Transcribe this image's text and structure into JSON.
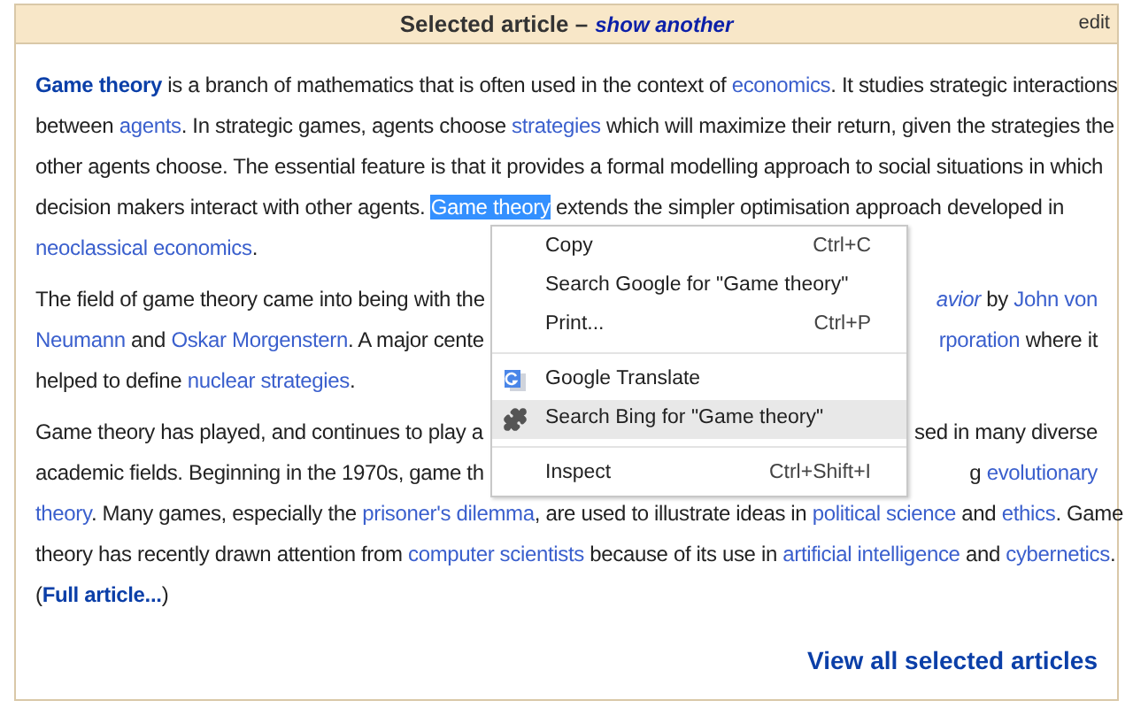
{
  "header": {
    "title": "Selected article –",
    "link": "show another",
    "edit": "edit"
  },
  "paragraphs": [
    [
      {
        "left": [
          {
            "text": "Game theory",
            "link": true,
            "bold": true
          },
          {
            "text": " is a branch of mathematics that is often used in the context of "
          },
          {
            "text": "economics",
            "link": true
          },
          {
            "text": ". It studies strategic interactions"
          }
        ]
      },
      {
        "left": [
          {
            "text": "between "
          },
          {
            "text": "agents",
            "link": true
          },
          {
            "text": ". In strategic games, agents choose "
          },
          {
            "text": "strategies",
            "link": true
          },
          {
            "text": " which will maximize their return, given the strategies the"
          }
        ]
      },
      {
        "left": [
          {
            "text": "other agents choose. The essential feature is that it provides a formal modelling approach to social situations in which"
          }
        ]
      },
      {
        "left": [
          {
            "text": "decision makers interact with other agents. "
          },
          {
            "text": "Game theory",
            "highlighted": true
          },
          {
            "text": " extends the simpler optimisation approach developed in"
          }
        ]
      },
      {
        "left": [
          {
            "text": "neoclassical economics",
            "link": true
          },
          {
            "text": "."
          }
        ]
      }
    ],
    [
      {
        "left": [
          {
            "text": "The field of game theory came into being with the"
          }
        ],
        "right": [
          {
            "text": "avior",
            "link": true,
            "italic": true
          },
          {
            "text": " by "
          },
          {
            "text": "John von",
            "link": true
          }
        ]
      },
      {
        "left": [
          {
            "text": "Neumann",
            "link": true
          },
          {
            "text": " and "
          },
          {
            "text": "Oskar Morgenstern",
            "link": true
          },
          {
            "text": ". A major cente"
          }
        ],
        "right": [
          {
            "text": "rporation",
            "link": true
          },
          {
            "text": " where it"
          }
        ]
      },
      {
        "left": [
          {
            "text": "helped to define "
          },
          {
            "text": "nuclear strategies",
            "link": true
          },
          {
            "text": "."
          }
        ]
      }
    ],
    [
      {
        "left": [
          {
            "text": "Game theory has played, and continues to play a"
          }
        ],
        "right": [
          {
            "text": "sed in many diverse"
          }
        ]
      },
      {
        "left": [
          {
            "text": "academic fields. Beginning in the 1970s, game th"
          }
        ],
        "right": [
          {
            "text": "g "
          },
          {
            "text": "evolutionary",
            "link": true
          }
        ]
      },
      {
        "left": [
          {
            "text": "theory",
            "link": true
          },
          {
            "text": ". Many games, especially the "
          },
          {
            "text": "prisoner's dilemma",
            "link": true
          },
          {
            "text": ", are used to illustrate ideas in "
          },
          {
            "text": "political science",
            "link": true
          },
          {
            "text": " and "
          },
          {
            "text": "ethics",
            "link": true
          },
          {
            "text": ". Game"
          }
        ]
      },
      {
        "left": [
          {
            "text": "theory has recently drawn attention from "
          },
          {
            "text": "computer scientists",
            "link": true
          },
          {
            "text": " because of its use in "
          },
          {
            "text": "artificial intelligence",
            "link": true
          },
          {
            "text": " and "
          },
          {
            "text": "cybernetics",
            "link": true
          },
          {
            "text": "."
          }
        ]
      },
      {
        "left": [
          {
            "text": "("
          },
          {
            "text": "Full article...",
            "link": true,
            "bold": true
          },
          {
            "text": ")"
          }
        ]
      }
    ]
  ],
  "footer_link": "View all selected articles",
  "context_menu": [
    {
      "kind": "item",
      "label": "Copy",
      "shortcut": "Ctrl+C",
      "selected": false
    },
    {
      "kind": "item",
      "label": "Search Google for \"Game theory\"",
      "selected": false
    },
    {
      "kind": "item",
      "label": "Print...",
      "shortcut": "Ctrl+P",
      "selected": false
    },
    {
      "kind": "separator"
    },
    {
      "kind": "translate",
      "label": "Google Translate",
      "selected": false
    },
    {
      "kind": "extension",
      "label": "Search Bing for \"Game theory\"",
      "selected": true
    },
    {
      "kind": "separator"
    },
    {
      "kind": "item",
      "label": "Inspect",
      "shortcut": "Ctrl+Shift+I",
      "selected": false
    }
  ]
}
